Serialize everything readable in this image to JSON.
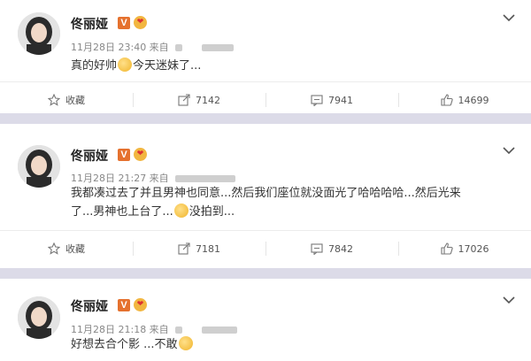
{
  "colors": {
    "accent": "#e5712e",
    "separator": "#dcdbe8"
  },
  "icons": {
    "favorite": "star-outline-icon",
    "repost": "share-arrow-icon",
    "comment": "comment-bubble-icon",
    "like": "thumbs-up-icon",
    "more": "chevron-down-icon"
  },
  "posts": [
    {
      "author": "佟丽娅",
      "verified_badge": "V",
      "time": "11月28日 23:40 来自",
      "text_part1": "真的好帅",
      "text_part2": "今天迷妹了...",
      "favorite_label": "收藏",
      "repost_count": "7142",
      "comment_count": "7941",
      "like_count": "14699"
    },
    {
      "author": "佟丽娅",
      "verified_badge": "V",
      "time": "11月28日 21:27 来自",
      "text_line1": "我都凑过去了并且男神也同意...然后我们座位就没面光了哈哈哈哈...然后光来",
      "text_line2_part1": "了...男神也上台了...",
      "text_line2_part2": "没拍到...",
      "favorite_label": "收藏",
      "repost_count": "7181",
      "comment_count": "7842",
      "like_count": "17026"
    },
    {
      "author": "佟丽娅",
      "verified_badge": "V",
      "time": "11月28日 21:18 来自",
      "text_part1": "好想去合个影 ...不敢"
    }
  ]
}
